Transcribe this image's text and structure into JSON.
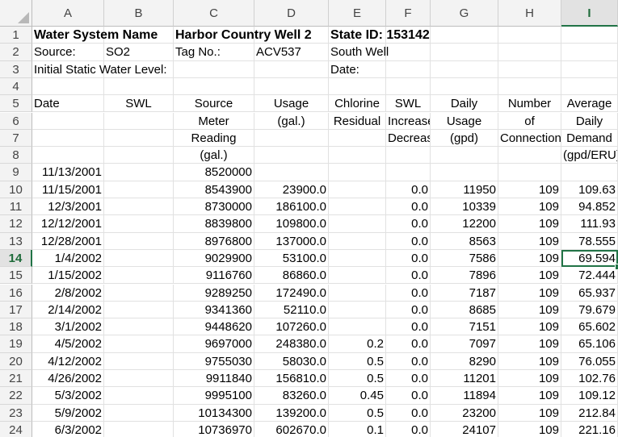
{
  "column_headers": [
    "A",
    "B",
    "C",
    "D",
    "E",
    "F",
    "G",
    "H",
    "I"
  ],
  "active_column": "I",
  "active_row": 14,
  "header_rows": [
    {
      "row": 1,
      "bold": true,
      "cells": {
        "A": "Water System Name",
        "C": "Harbor Country Well 2",
        "E": "State ID: 153142"
      }
    },
    {
      "row": 2,
      "cells": {
        "A": "Source:",
        "B": "SO2",
        "C": "Tag No.:",
        "D": "ACV537",
        "E": "South Well"
      }
    },
    {
      "row": 3,
      "cells": {
        "A": "Initial Static Water Level:",
        "E": "Date:"
      }
    },
    {
      "row": 4,
      "cells": {}
    },
    {
      "row": 5,
      "cells": {
        "A": "Date",
        "B": "SWL",
        "C": "Source",
        "D": "Usage",
        "E": "Chlorine",
        "F": "SWL",
        "G": "Daily",
        "H": "Number",
        "I": "Average"
      }
    },
    {
      "row": 6,
      "cells": {
        "C": "Meter",
        "D": "(gal.)",
        "E": "Residual",
        "F": "Increase",
        "G": "Usage",
        "H": "of",
        "I": "Daily"
      }
    },
    {
      "row": 7,
      "cells": {
        "C": "Reading",
        "F": "Decrease",
        "G": "(gpd)",
        "H": "Connections",
        "I": "Demand"
      }
    },
    {
      "row": 8,
      "cells": {
        "C": "(gal.)",
        "I": "(gpd/ERU)"
      }
    }
  ],
  "data_rows": [
    {
      "row": 9,
      "A": "11/13/2001",
      "C": "8520000"
    },
    {
      "row": 10,
      "A": "11/15/2001",
      "C": "8543900",
      "D": "23900.0",
      "F": "0.0",
      "G": "11950",
      "H": "109",
      "I": "109.63"
    },
    {
      "row": 11,
      "A": "12/3/2001",
      "C": "8730000",
      "D": "186100.0",
      "F": "0.0",
      "G": "10339",
      "H": "109",
      "I": "94.852"
    },
    {
      "row": 12,
      "A": "12/12/2001",
      "C": "8839800",
      "D": "109800.0",
      "F": "0.0",
      "G": "12200",
      "H": "109",
      "I": "111.93"
    },
    {
      "row": 13,
      "A": "12/28/2001",
      "C": "8976800",
      "D": "137000.0",
      "F": "0.0",
      "G": "8563",
      "H": "109",
      "I": "78.555"
    },
    {
      "row": 14,
      "A": "1/4/2002",
      "C": "9029900",
      "D": "53100.0",
      "F": "0.0",
      "G": "7586",
      "H": "109",
      "I": "69.594"
    },
    {
      "row": 15,
      "A": "1/15/2002",
      "C": "9116760",
      "D": "86860.0",
      "F": "0.0",
      "G": "7896",
      "H": "109",
      "I": "72.444"
    },
    {
      "row": 16,
      "A": "2/8/2002",
      "C": "9289250",
      "D": "172490.0",
      "F": "0.0",
      "G": "7187",
      "H": "109",
      "I": "65.937"
    },
    {
      "row": 17,
      "A": "2/14/2002",
      "C": "9341360",
      "D": "52110.0",
      "F": "0.0",
      "G": "8685",
      "H": "109",
      "I": "79.679"
    },
    {
      "row": 18,
      "A": "3/1/2002",
      "C": "9448620",
      "D": "107260.0",
      "F": "0.0",
      "G": "7151",
      "H": "109",
      "I": "65.602"
    },
    {
      "row": 19,
      "A": "4/5/2002",
      "C": "9697000",
      "D": "248380.0",
      "E": "0.2",
      "F": "0.0",
      "G": "7097",
      "H": "109",
      "I": "65.106"
    },
    {
      "row": 20,
      "A": "4/12/2002",
      "C": "9755030",
      "D": "58030.0",
      "E": "0.5",
      "F": "0.0",
      "G": "8290",
      "H": "109",
      "I": "76.055"
    },
    {
      "row": 21,
      "A": "4/26/2002",
      "C": "9911840",
      "D": "156810.0",
      "E": "0.5",
      "F": "0.0",
      "G": "11201",
      "H": "109",
      "I": "102.76"
    },
    {
      "row": 22,
      "A": "5/3/2002",
      "C": "9995100",
      "D": "83260.0",
      "E": "0.45",
      "F": "0.0",
      "G": "11894",
      "H": "109",
      "I": "109.12"
    },
    {
      "row": 23,
      "A": "5/9/2002",
      "C": "10134300",
      "D": "139200.0",
      "E": "0.5",
      "F": "0.0",
      "G": "23200",
      "H": "109",
      "I": "212.84"
    },
    {
      "row": 24,
      "A": "6/3/2002",
      "C": "10736970",
      "D": "602670.0",
      "E": "0.1",
      "F": "0.0",
      "G": "24107",
      "H": "109",
      "I": "221.16"
    }
  ]
}
